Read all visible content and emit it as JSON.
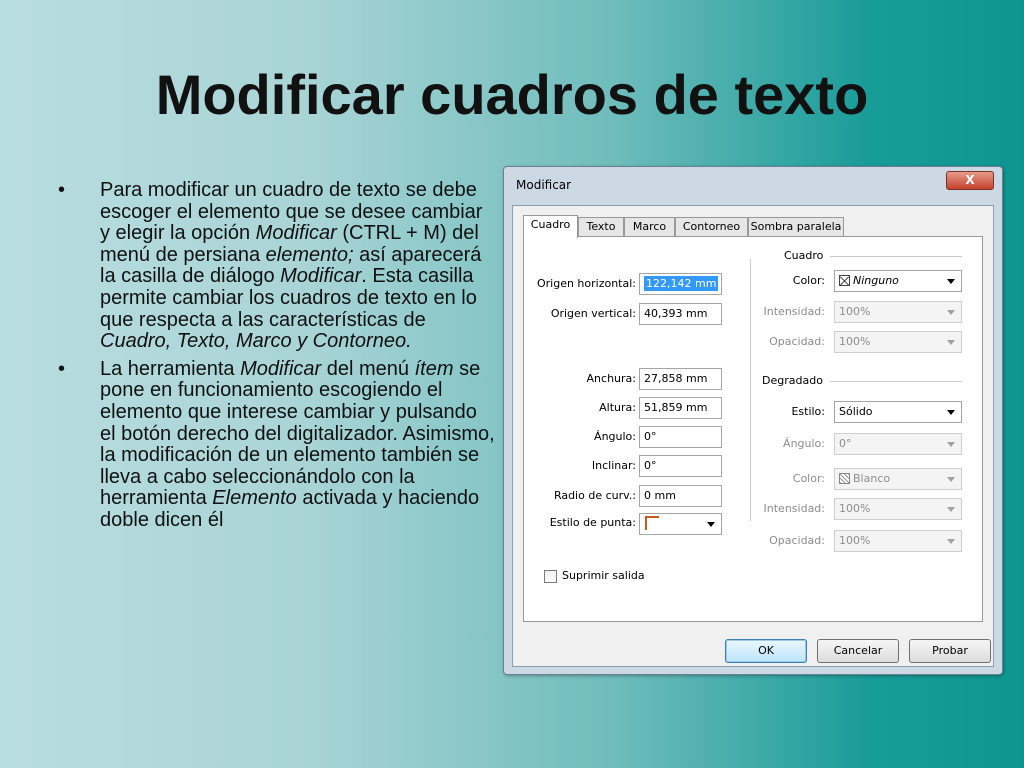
{
  "slide": {
    "title": "Modificar cuadros de texto",
    "bullet_char": "•",
    "bullet1": {
      "t1": "Para modificar un cuadro de texto se debe escoger el elemento que se desee cambiar y elegir la opción ",
      "i1": "Modificar",
      "t2": " (CTRL + M) del menú de persiana ",
      "i2": "elemento;",
      "t3": " así aparecerá la casilla de diálogo ",
      "i3": "Modificar",
      "t4": ". Esta casilla permite cambiar los cuadros de texto en lo que respecta a las características de ",
      "i4": "Cuadro, Texto, Marco y Contorneo."
    },
    "bullet2": {
      "t1": "La herramienta ",
      "i1": "Modificar",
      "t2": " del menú ",
      "i2": "ítem",
      "t3": " se pone en funcionamiento escogiendo el elemento que interese cambiar y pulsando el botón derecho del digitalizador. Asimismo, la modificación de un elemento también se lleva a cabo seleccionándolo con la herramienta ",
      "i3": "Elemento",
      "t4": " activada y haciendo doble dicen él"
    }
  },
  "dialog": {
    "title": "Modificar",
    "close_label": "X",
    "tabs": [
      "Cuadro",
      "Texto",
      "Marco",
      "Contorneo",
      "Sombra paralela"
    ],
    "left": {
      "origen_h_label": "Origen horizontal:",
      "origen_h_value": "122,142 mm",
      "origen_v_label": "Origen vertical:",
      "origen_v_value": "40,393 mm",
      "anchura_label": "Anchura:",
      "anchura_value": "27,858 mm",
      "altura_label": "Altura:",
      "altura_value": "51,859 mm",
      "angulo_label": "Ángulo:",
      "angulo_value": "0°",
      "inclinar_label": "Inclinar:",
      "inclinar_value": "0°",
      "radio_label": "Radio de curv.:",
      "radio_value": "0 mm",
      "estilo_punta_label": "Estilo de punta:",
      "suprimir_label": "Suprimir salida"
    },
    "cuadro": {
      "title": "Cuadro",
      "color_label": "Color:",
      "color_value": "Ninguno",
      "intensidad_label": "Intensidad:",
      "intensidad_value": "100%",
      "opacidad_label": "Opacidad:",
      "opacidad_value": "100%"
    },
    "degradado": {
      "title": "Degradado",
      "estilo_label": "Estilo:",
      "estilo_value": "Sólido",
      "angulo_label": "Ángulo:",
      "angulo_value": "0°",
      "color_label": "Color:",
      "color_value": "Blanco",
      "intensidad_label": "Intensidad:",
      "intensidad_value": "100%",
      "opacidad_label": "Opacidad:",
      "opacidad_value": "100%"
    },
    "buttons": {
      "ok": "OK",
      "cancel": "Cancelar",
      "try": "Probar"
    }
  }
}
